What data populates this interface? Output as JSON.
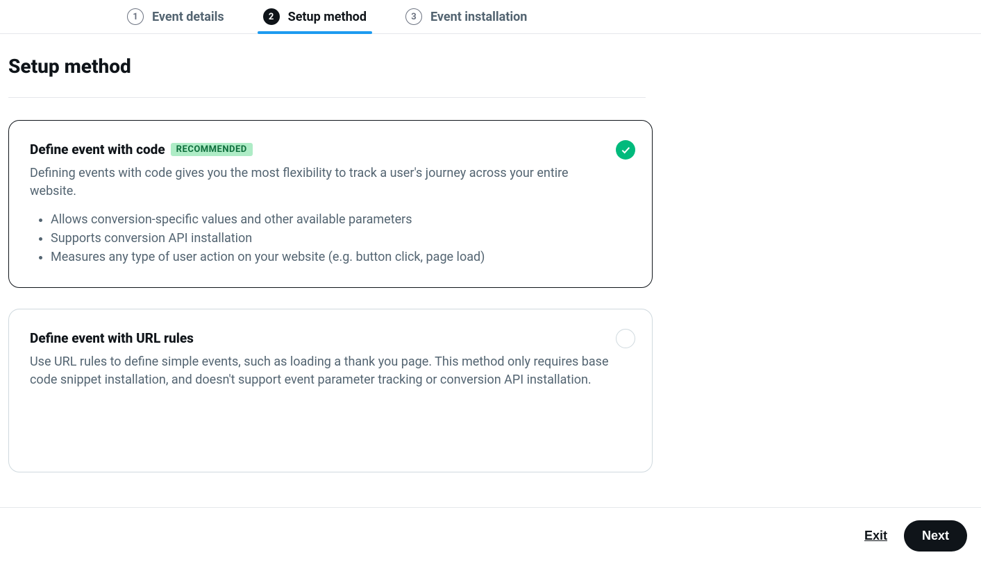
{
  "stepper": {
    "steps": [
      {
        "num": "1",
        "label": "Event details",
        "active": false
      },
      {
        "num": "2",
        "label": "Setup method",
        "active": true
      },
      {
        "num": "3",
        "label": "Event installation",
        "active": false
      }
    ]
  },
  "page": {
    "title": "Setup method"
  },
  "options": [
    {
      "title": "Define event with code",
      "badge": "RECOMMENDED",
      "selected": true,
      "description": "Defining events with code gives you the most flexibility to track a user's journey across your entire website.",
      "bullets": [
        "Allows conversion-specific values and other available parameters",
        "Supports conversion API installation",
        "Measures any type of user action on your website (e.g. button click, page load)"
      ]
    },
    {
      "title": "Define event with URL rules",
      "badge": null,
      "selected": false,
      "description": "Use URL rules to define simple events, such as loading a thank you page. This method only requires base code snippet installation, and doesn't support event parameter tracking or conversion API installation.",
      "bullets": []
    }
  ],
  "footer": {
    "exit": "Exit",
    "next": "Next"
  }
}
